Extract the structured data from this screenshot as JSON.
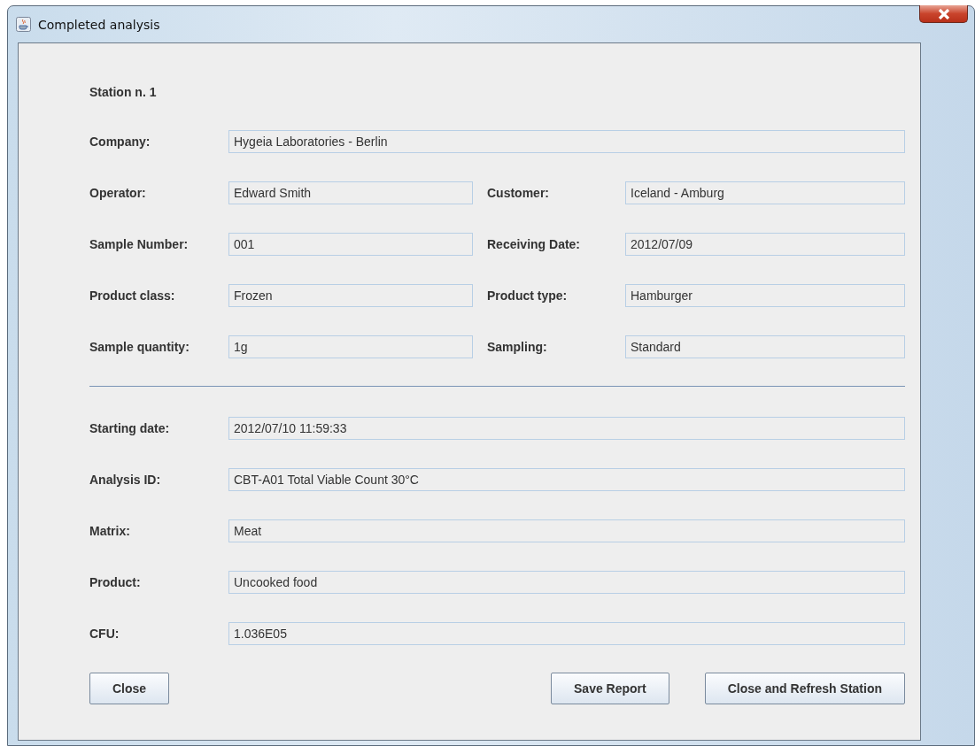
{
  "window": {
    "title": "Completed analysis"
  },
  "station": "Station n. 1",
  "sample_fields": [
    [
      {
        "label": "Company:",
        "value": "Hygeia Laboratories - Berlin"
      }
    ],
    [
      {
        "label": "Operator:",
        "value": "Edward Smith"
      },
      {
        "label": "Customer:",
        "value": "Iceland - Amburg"
      }
    ],
    [
      {
        "label": "Sample Number:",
        "value": "001"
      },
      {
        "label": "Receiving Date:",
        "value": "2012/07/09"
      }
    ],
    [
      {
        "label": "Product class:",
        "value": "Frozen"
      },
      {
        "label": "Product type:",
        "value": "Hamburger"
      }
    ],
    [
      {
        "label": "Sample quantity:",
        "value": "1g"
      },
      {
        "label": "Sampling:",
        "value": "Standard"
      }
    ]
  ],
  "analysis_fields": [
    {
      "label": "Starting date:",
      "value": "2012/07/10 11:59:33"
    },
    {
      "label": "Analysis ID:",
      "value": "CBT-A01 Total Viable Count 30°C"
    },
    {
      "label": "Matrix:",
      "value": "Meat"
    },
    {
      "label": "Product:",
      "value": "Uncooked food"
    },
    {
      "label": "CFU:",
      "value": "1.036E05"
    }
  ],
  "buttons": [
    {
      "label": "Close",
      "kind": "left"
    },
    {
      "label": "Save Report",
      "kind": "right"
    },
    {
      "label": "Close and Refresh Station",
      "kind": "right"
    }
  ]
}
